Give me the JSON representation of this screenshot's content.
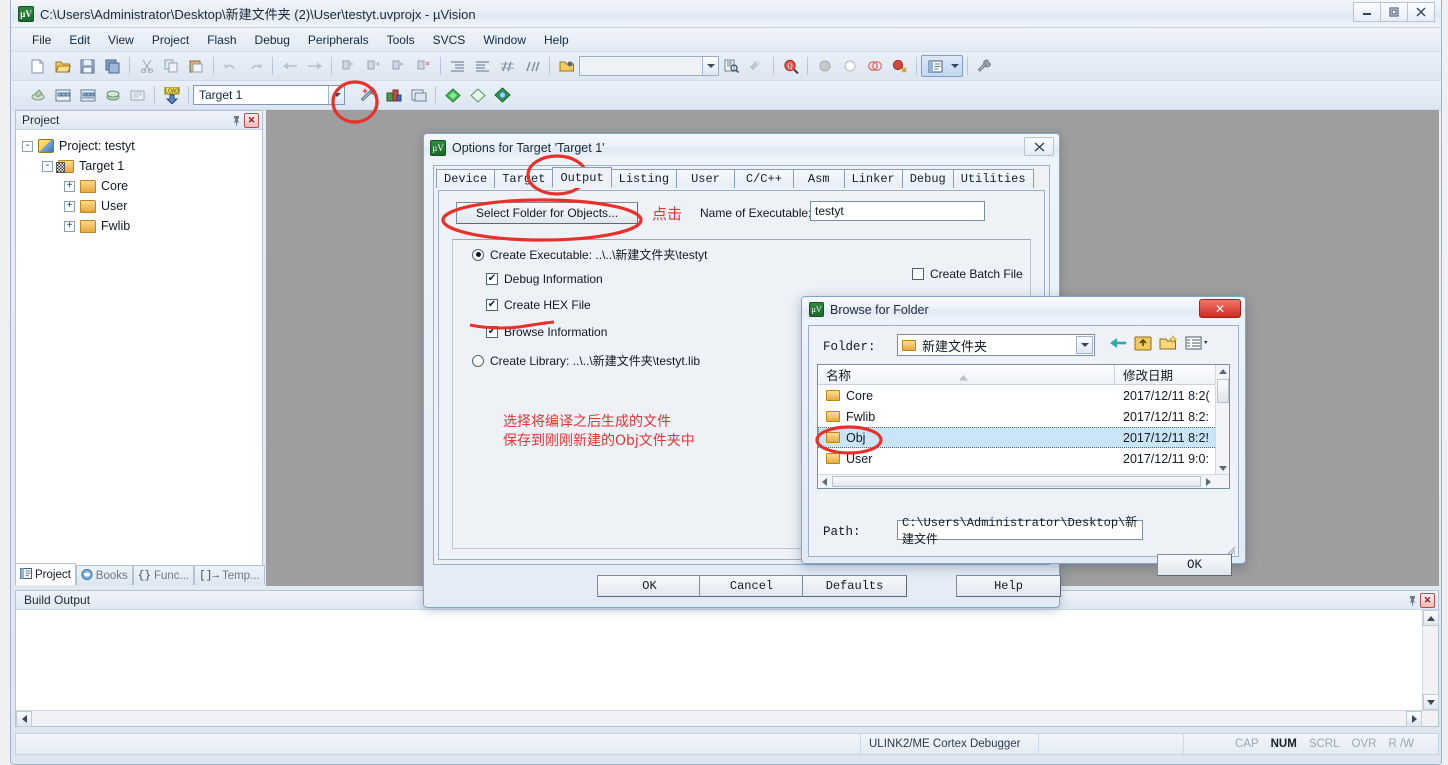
{
  "window": {
    "title": "C:\\Users\\Administrator\\Desktop\\新建文件夹 (2)\\User\\testyt.uvprojx - µVision",
    "app_icon": "uvision-logo-icon",
    "minimize": "–",
    "maximize": "❐",
    "close": "✕"
  },
  "menu": [
    {
      "label": "File"
    },
    {
      "label": "Edit"
    },
    {
      "label": "View"
    },
    {
      "label": "Project"
    },
    {
      "label": "Flash"
    },
    {
      "label": "Debug"
    },
    {
      "label": "Peripherals"
    },
    {
      "label": "Tools"
    },
    {
      "label": "SVCS"
    },
    {
      "label": "Window"
    },
    {
      "label": "Help"
    }
  ],
  "toolbar2": {
    "target_combo_value": "Target 1",
    "search_box_value": ""
  },
  "project_panel": {
    "title": "Project",
    "pin_icon": "pin-icon",
    "close_icon": "close-icon",
    "tree": [
      {
        "label": "Project: testyt",
        "level": 0,
        "expander": "-",
        "icon": "project-icon"
      },
      {
        "label": "Target 1",
        "level": 1,
        "expander": "-",
        "icon": "target-icon"
      },
      {
        "label": "Core",
        "level": 2,
        "expander": "+",
        "icon": "folder-icon"
      },
      {
        "label": "User",
        "level": 2,
        "expander": "+",
        "icon": "folder-icon"
      },
      {
        "label": "Fwlib",
        "level": 2,
        "expander": "+",
        "icon": "folder-icon"
      }
    ],
    "tabs": [
      {
        "label": "Project",
        "icon": "project-tab-icon",
        "active": true
      },
      {
        "label": "Books",
        "icon": "books-icon",
        "active": false
      },
      {
        "label": "Func...",
        "icon": "functions-icon",
        "active": false
      },
      {
        "label": "Temp...",
        "icon": "templates-icon",
        "active": false
      }
    ]
  },
  "build_output": {
    "title": "Build Output",
    "pin_icon": "pin-icon",
    "close_icon": "close-icon",
    "content": ""
  },
  "status_bar": {
    "debugger": "ULINK2/ME Cortex Debugger",
    "indicators": [
      {
        "label": "CAP",
        "active": false
      },
      {
        "label": "NUM",
        "active": true
      },
      {
        "label": "SCRL",
        "active": false
      },
      {
        "label": "OVR",
        "active": false
      },
      {
        "label": "R /W",
        "active": false
      }
    ]
  },
  "options_dialog": {
    "title": "Options for Target 'Target 1'",
    "icon": "uvision-logo-icon",
    "close": "✕",
    "tabs": [
      {
        "label": "Device",
        "active": false
      },
      {
        "label": "Target",
        "active": false
      },
      {
        "label": "Output",
        "active": true
      },
      {
        "label": "Listing",
        "active": false
      },
      {
        "label": "User",
        "active": false
      },
      {
        "label": "C/C++",
        "active": false
      },
      {
        "label": "Asm",
        "active": false
      },
      {
        "label": "Linker",
        "active": false
      },
      {
        "label": "Debug",
        "active": false
      },
      {
        "label": "Utilities",
        "active": false
      }
    ],
    "select_folder_button": "Select Folder for Objects...",
    "name_of_executable_label": "Name of Executable:",
    "name_of_executable_value": "testyt",
    "create_executable_label": "Create Executable:  ..\\..\\新建文件夹\\testyt",
    "create_executable_selected": true,
    "debug_information": {
      "label": "Debug Information",
      "checked": true
    },
    "create_hex_file": {
      "label": "Create HEX File",
      "checked": true
    },
    "browse_information": {
      "label": "Browse Information",
      "checked": true
    },
    "create_batch_file": {
      "label": "Create Batch File",
      "checked": false
    },
    "create_library_label": "Create Library:  ..\\..\\新建文件夹\\testyt.lib",
    "create_library_selected": false,
    "footer_buttons": [
      {
        "label": "OK"
      },
      {
        "label": "Cancel"
      },
      {
        "label": "Defaults"
      },
      {
        "label": "Help"
      }
    ]
  },
  "browse_dialog": {
    "title": "Browse for Folder",
    "icon": "uvision-logo-icon",
    "close": "✕",
    "folder_label": "Folder:",
    "folder_value": "新建文件夹",
    "toolbar_icons": [
      "back-arrow-icon",
      "up-folder-icon",
      "new-folder-icon",
      "view-mode-icon"
    ],
    "columns": [
      "名称",
      "修改日期"
    ],
    "rows": [
      {
        "name": "Core",
        "date": "2017/12/11 8:2(",
        "selected": false
      },
      {
        "name": "Fwlib",
        "date": "2017/12/11 8:2:",
        "selected": false
      },
      {
        "name": "Obj",
        "date": "2017/12/11 8:2!",
        "selected": true
      },
      {
        "name": "User",
        "date": "2017/12/11 9:0:",
        "selected": false
      }
    ],
    "path_label": "Path:",
    "path_value": "C:\\Users\\Administrator\\Desktop\\新建文件",
    "ok_button": "OK"
  },
  "annotations": {
    "click_here": "点击",
    "note_line1": "选择将编译之后生成的文件",
    "note_line2": "保存到刚刚新建的Obj文件夹中",
    "pen_color": "#e03636"
  }
}
